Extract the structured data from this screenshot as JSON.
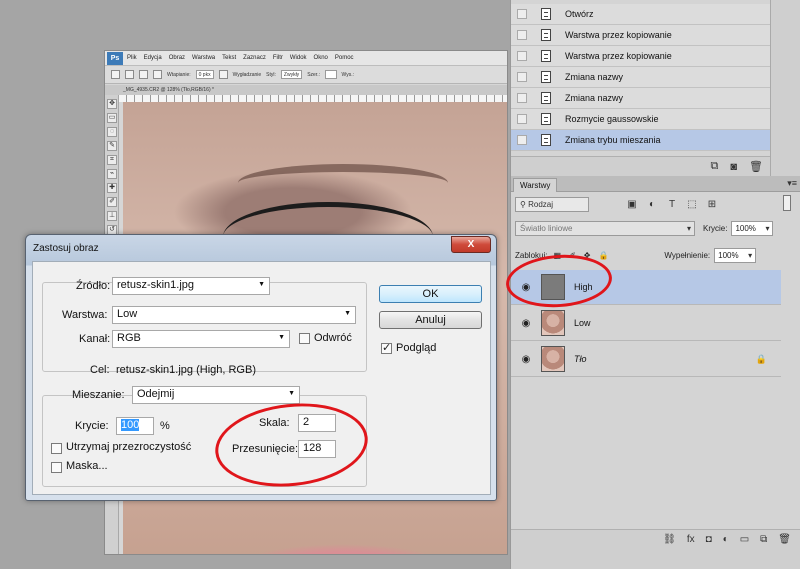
{
  "photoshop": {
    "logo": "Ps",
    "menu": [
      "Plik",
      "Edycja",
      "Obraz",
      "Warstwa",
      "Tekst",
      "Zaznacz",
      "Filtr",
      "Widok",
      "Okno",
      "Pomoc"
    ],
    "options": {
      "feather_label": "Wtapianie:",
      "feather_value": "0 pkx",
      "antialias_label": "Wygładzanie",
      "style_label": "Styl:",
      "style_value": "Zwykły",
      "width_label": "Szer.:",
      "height_label": "Wys.:"
    },
    "document_tab": "_MG_4935.CR2 @ 128% (Tło,RGB/16) *"
  },
  "history": {
    "items": [
      {
        "label": "Otwórz"
      },
      {
        "label": "Warstwa przez kopiowanie"
      },
      {
        "label": "Warstwa przez kopiowanie"
      },
      {
        "label": "Zmiana nazwy"
      },
      {
        "label": "Zmiana nazwy"
      },
      {
        "label": "Rozmycie gaussowskie"
      },
      {
        "label": "Zmiana trybu mieszania"
      }
    ],
    "selected_index": 6
  },
  "layers": {
    "tab": "Warstwy",
    "filter_kind": "Rodzaj",
    "blend_mode": "Światło liniowe",
    "opacity_label": "Krycie:",
    "opacity_value": "100%",
    "lock_label": "Zablokuj:",
    "fill_label": "Wypełnienie:",
    "fill_value": "100%",
    "items": [
      {
        "name": "High",
        "selected": true
      },
      {
        "name": "Low",
        "selected": false
      },
      {
        "name": "Tło",
        "selected": false,
        "locked": true
      }
    ]
  },
  "dialog": {
    "title": "Zastosuj obraz",
    "close": "X",
    "source_label": "Źródło:",
    "source_value": "retusz-skin1.jpg",
    "layer_label": "Warstwa:",
    "layer_value": "Low",
    "channel_label": "Kanał:",
    "channel_value": "RGB",
    "invert_label": "Odwróć",
    "target_label": "Cel:",
    "target_value": "retusz-skin1.jpg (High, RGB)",
    "blending_label": "Mieszanie:",
    "blending_value": "Odejmij",
    "opacity_label": "Krycie:",
    "opacity_value": "100",
    "percent": "%",
    "scale_label": "Skala:",
    "scale_value": "2",
    "offset_label": "Przesunięcie:",
    "offset_value": "128",
    "preserve_transparency_label": "Utrzymaj przezroczystość",
    "mask_label": "Maska...",
    "ok_label": "OK",
    "cancel_label": "Anuluj",
    "preview_label": "Podgląd",
    "preview_checked": true
  },
  "colors": {
    "selection_blue": "#b6c8e6",
    "annotation_red": "#e0161b"
  }
}
